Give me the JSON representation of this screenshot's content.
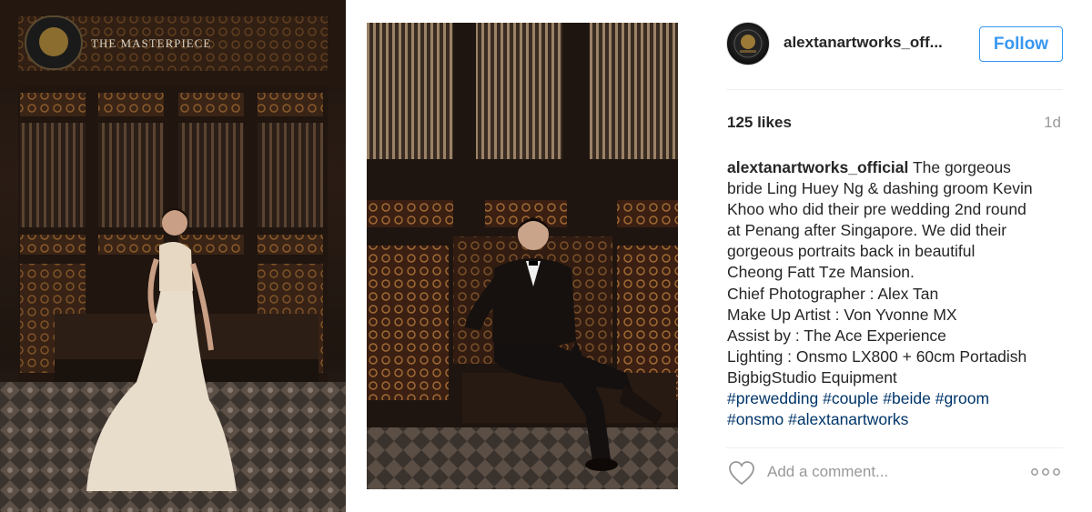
{
  "post": {
    "images": [
      {
        "name": "bride-photo",
        "watermark": "THE MASTERPIECE"
      },
      {
        "name": "groom-photo"
      }
    ],
    "header": {
      "username": "alextanartworks_off...",
      "follow_label": "Follow",
      "avatar_icon": "studio-logo-icon"
    },
    "stats": {
      "likes": "125 likes",
      "time_ago": "1d"
    },
    "caption": {
      "username": "alextanartworks_official",
      "lines": [
        "The gorgeous",
        "bride Ling Huey Ng & dashing groom Kevin",
        "Khoo who did their pre wedding 2nd round",
        "at Penang after Singapore. We did their",
        "gorgeous portraits back in beautiful",
        "Cheong Fatt Tze Mansion.",
        "Chief Photographer : Alex Tan",
        "Make Up Artist : Von Yvonne MX",
        "Assist by : The Ace Experience",
        "Lighting : Onsmo LX800 + 60cm Portadish",
        "BigbigStudio Equipment"
      ],
      "hashtags": [
        "#prewedding",
        "#couple",
        "#beide",
        "#groom",
        "#onsmo",
        "#alextanartworks"
      ]
    },
    "comment": {
      "placeholder": "Add a comment...",
      "like_icon": "heart-outline-icon",
      "more_icon": "more-options-icon"
    },
    "colors": {
      "accent": "#3897f0",
      "hashtag": "#003569",
      "muted": "#999999",
      "text": "#262626"
    }
  }
}
